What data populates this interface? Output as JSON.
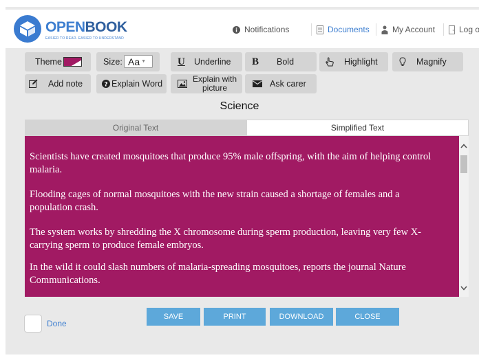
{
  "app": {
    "logo_open": "OPEN",
    "logo_book": "BOOK",
    "tagline": "EASIER TO READ. EASIER TO UNDERSTAND"
  },
  "nav": {
    "notifications": "Notifications",
    "documents": "Documents",
    "my_account": "My Account",
    "logout": "Log out"
  },
  "toolbar": {
    "theme": "Theme",
    "size_label": "Size:",
    "size_value": "Aa",
    "underline": "Underline",
    "bold": "Bold",
    "highlight": "Highlight",
    "magnify": "Magnify",
    "add_note": "Add note",
    "explain_word": "Explain Word",
    "explain_picture_line1": "Explain with",
    "explain_picture_line2": "picture",
    "ask_carer": "Ask carer"
  },
  "document": {
    "subject": "Science",
    "tabs": [
      "Original Text",
      "Simplified Text"
    ],
    "active_tab": "Simplified Text",
    "paragraphs": [
      "Scientists have created mosquitoes that produce 95% male offspring, with the aim of helping control malaria.",
      "Flooding cages of normal mosquitoes with the new strain caused a shortage of females and a population crash.",
      "The system works by shredding the X chromosome during sperm production, leaving very few X-carrying sperm to produce female embryos.",
      "In the wild it could slash numbers of malaria-spreading mosquitoes, reports the journal Nature Communications."
    ]
  },
  "footer": {
    "done": "Done",
    "save": "SAVE",
    "print": "PRINT",
    "download": "DOWNLOAD",
    "close": "CLOSE"
  },
  "colors": {
    "accent": "#3e7fd0",
    "content_bg": "#a11a63",
    "footer_button": "#5da8da"
  }
}
